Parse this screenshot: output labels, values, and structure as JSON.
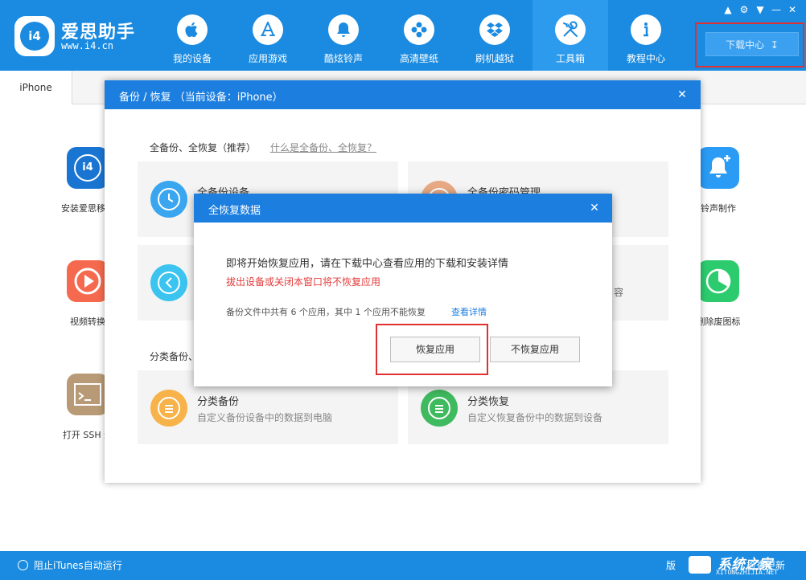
{
  "app": {
    "brand_name": "爱思助手",
    "brand_url": "www.i4.cn",
    "logo_text": "i4"
  },
  "nav": [
    {
      "label": "我的设备",
      "icon": "apple-icon"
    },
    {
      "label": "应用游戏",
      "icon": "app-store-icon"
    },
    {
      "label": "酷炫铃声",
      "icon": "bell-icon"
    },
    {
      "label": "高清壁纸",
      "icon": "flower-icon"
    },
    {
      "label": "刷机越狱",
      "icon": "dropbox-icon"
    },
    {
      "label": "工具箱",
      "icon": "tools-icon",
      "active": true
    },
    {
      "label": "教程中心",
      "icon": "info-icon"
    }
  ],
  "window_controls": [
    "shirt-icon",
    "gear-icon",
    "menu-icon",
    "minimize-icon",
    "close-icon"
  ],
  "download_center": {
    "label": "下载中心"
  },
  "tabs": [
    {
      "label": "iPhone"
    }
  ],
  "background_tools": [
    {
      "label": "安装爱思移动",
      "color": "#1a75d2"
    },
    {
      "label": "视频转换",
      "color": "#f56a4e"
    },
    {
      "label": "打开 SSH 通",
      "color": "#b89b76"
    },
    {
      "label": "铃声制作",
      "color": "#2a9cf5"
    },
    {
      "label": "删除废图标",
      "color": "#2ccc6e"
    }
  ],
  "backup_modal": {
    "title": "备份 / 恢复   （当前设备：iPhone）",
    "section1_title": "全备份、全恢复（推荐）",
    "section1_link": "什么是全备份、全恢复？",
    "section2_title": "分类备份、",
    "cards": {
      "full_backup_title": "全备份设备",
      "full_password_title": "全备份密码管理",
      "card3_fragment": "容",
      "category_backup_title": "分类备份",
      "category_backup_desc": "自定义备份设备中的数据到电脑",
      "category_restore_title": "分类恢复",
      "category_restore_desc": "自定义恢复备份中的数据到设备"
    }
  },
  "restore_dialog": {
    "title": "全恢复数据",
    "message": "即将开始恢复应用，请在下载中心查看应用的下载和安装详情",
    "warning": "拔出设备或关闭本窗口将不恢复应用",
    "info": "备份文件中共有 6 个应用，其中 1 个应用不能恢复",
    "details_link": "查看详情",
    "confirm_button": "恢复应用",
    "cancel_button": "不恢复应用"
  },
  "statusbar": {
    "itunes_toggle": "阻止iTunes自动运行",
    "right_fragment1": "版",
    "right_fragment2": "检查更新"
  },
  "watermark": {
    "text": "系统之家",
    "url": "XITONGZHIJIA.NET"
  },
  "colors": {
    "primary": "#1a8be0",
    "modal_header": "#1c7fe0",
    "highlight": "#e23030",
    "warning_text": "#e33b3b"
  }
}
